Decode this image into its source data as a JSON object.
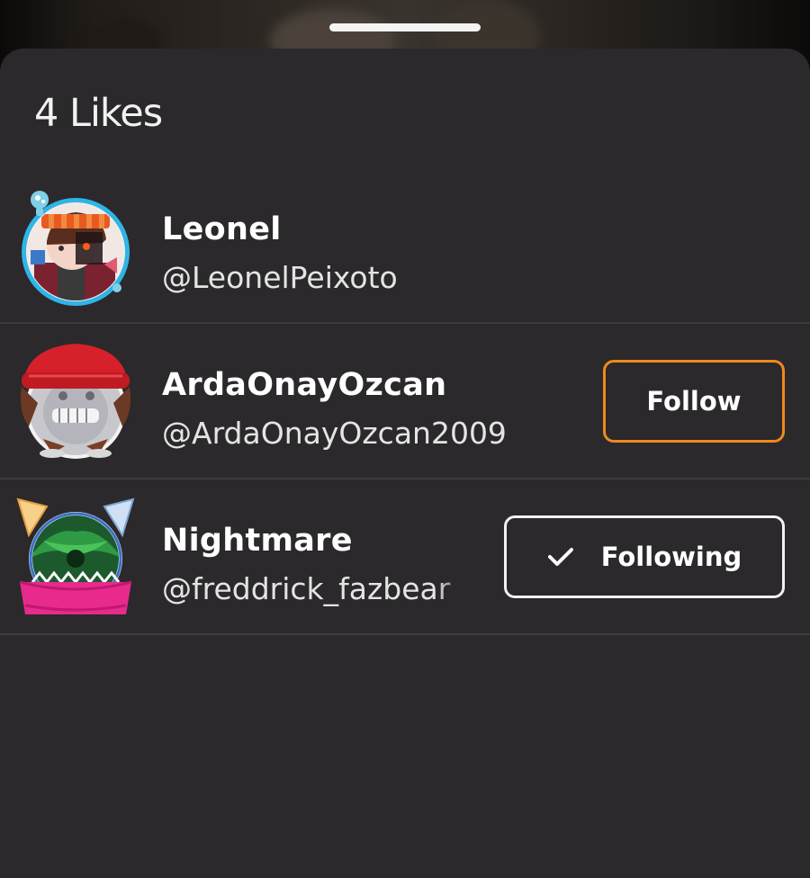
{
  "sheet": {
    "title": "4 Likes"
  },
  "users": [
    {
      "display_name": "Leonel",
      "handle": "@LeonelPeixoto",
      "button": null
    },
    {
      "display_name": "ArdaOnayOzcan",
      "handle": "@ArdaOnayOzcan2009",
      "button": {
        "label": "Follow",
        "state": "follow"
      }
    },
    {
      "display_name": "Nightmare",
      "handle": "@freddrick_fazbear",
      "button": {
        "label": "Following",
        "state": "following",
        "icon": "checkmark-icon"
      }
    }
  ],
  "colors": {
    "sheet_background": "#2b292b",
    "follow_border": "#ef8a1c",
    "following_border": "#f2f2f2",
    "divider": "#3d3b3d"
  }
}
